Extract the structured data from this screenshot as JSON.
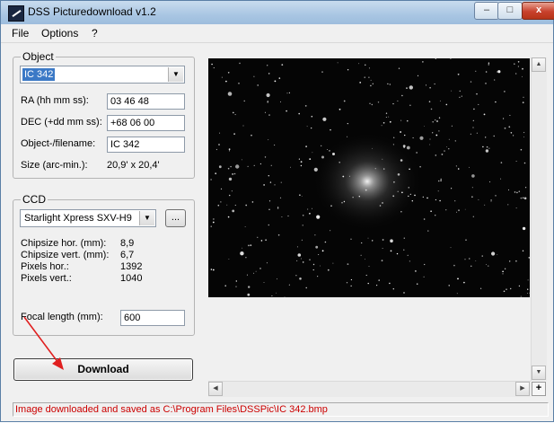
{
  "window": {
    "title": "DSS Picturedownload  v1.2",
    "controls": {
      "minimize": "–",
      "maximize": "□",
      "close": "x"
    }
  },
  "menu": {
    "items": [
      "File",
      "Options",
      "?"
    ]
  },
  "object_group": {
    "legend": "Object",
    "selected": "IC  342",
    "ra_label": "RA (hh mm ss):",
    "ra_value": "03 46 48",
    "dec_label": "DEC (+dd mm ss):",
    "dec_value": "+68 06 00",
    "filename_label": "Object-/filename:",
    "filename_value": "IC  342",
    "size_label": "Size (arc-min.):",
    "size_value": "20,9' x 20,4'"
  },
  "ccd_group": {
    "legend": "CCD",
    "selected": "Starlight Xpress SXV-H9",
    "browse_label": "...",
    "chip_hor_label": "Chipsize hor. (mm):",
    "chip_hor_value": "8,9",
    "chip_vert_label": "Chipsize vert. (mm):",
    "chip_vert_value": "6,7",
    "pix_hor_label": "Pixels hor.:",
    "pix_hor_value": "1392",
    "pix_vert_label": "Pixels vert.:",
    "pix_vert_value": "1040",
    "focal_label": "Focal length (mm):",
    "focal_value": "600"
  },
  "download_label": "Download",
  "status": "Image downloaded and saved as  C:\\Program Files\\DSSPic\\IC  342.bmp",
  "colors": {
    "status_text": "#cc0000",
    "selection": "#3b79c6",
    "annotation_arrow": "#e02020"
  },
  "icons": {
    "app": "dss-app-icon",
    "dropdown": "chevron-down-icon",
    "scroll_up": "arrow-up-icon",
    "scroll_down": "arrow-down-icon",
    "scroll_left": "arrow-left-icon",
    "scroll_right": "arrow-right-icon",
    "zoom": "plus-icon"
  },
  "scroll": {
    "up": "▲",
    "down": "▼",
    "left": "◀",
    "right": "▶",
    "corner": "+"
  }
}
